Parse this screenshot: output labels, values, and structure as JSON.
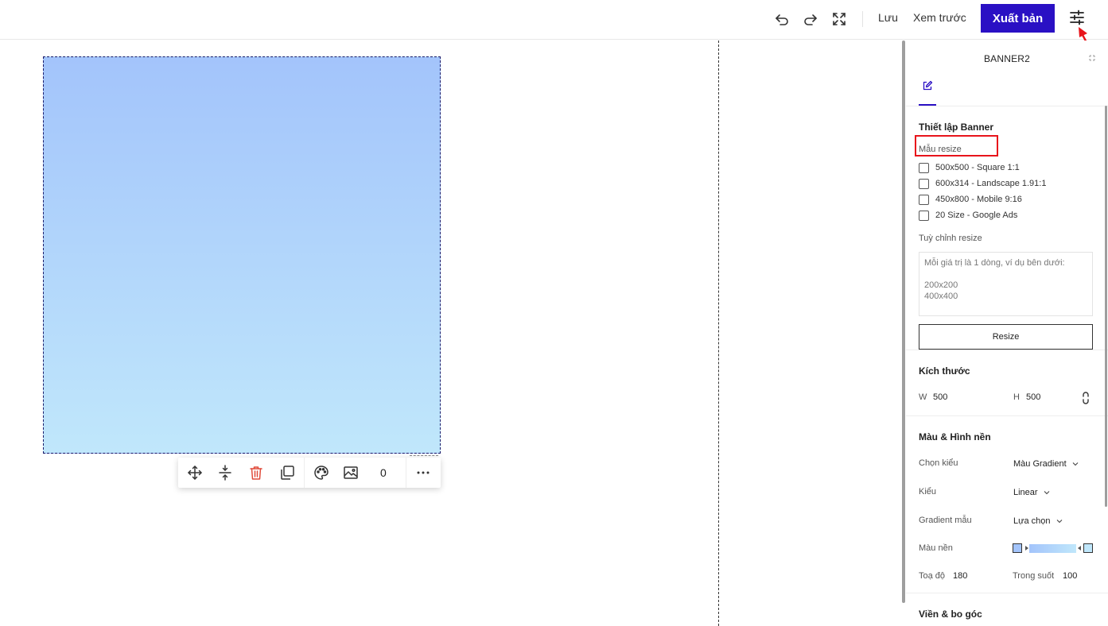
{
  "toolbar": {
    "save_label": "Lưu",
    "preview_label": "Xem trước",
    "publish_label": "Xuất bản"
  },
  "float_toolbar": {
    "layer_count": "0"
  },
  "panel": {
    "title": "BANNER2",
    "banner_settings": {
      "title": "Thiết lập Banner",
      "presets_label": "Mẫu resize",
      "presets": [
        {
          "label": "500x500 - Square 1:1",
          "checked": false
        },
        {
          "label": "600x314 - Landscape 1.91:1",
          "checked": false
        },
        {
          "label": "450x800 - Mobile 9:16",
          "checked": false
        },
        {
          "label": "20 Size - Google Ads",
          "checked": false
        }
      ],
      "custom_label": "Tuỳ chỉnh resize",
      "custom_placeholder": "Mỗi giá trị là 1 dòng, ví dụ bên dưới:\n\n200x200\n400x400",
      "resize_button": "Resize"
    },
    "size": {
      "title": "Kích thước",
      "w_label": "W",
      "w_value": "500",
      "h_label": "H",
      "h_value": "500"
    },
    "background": {
      "title": "Màu & Hình nền",
      "type_label": "Chọn kiểu",
      "type_value": "Màu Gradient",
      "style_label": "Kiểu",
      "style_value": "Linear",
      "preset_label": "Gradient mẫu",
      "preset_value": "Lựa chọn",
      "color_label": "Màu nền",
      "color_start": "#a3c4fb",
      "color_end": "#c0e7fb",
      "angle_label": "Toạ độ",
      "angle_value": "180",
      "opacity_label": "Trong suốt",
      "opacity_value": "100"
    },
    "border": {
      "title": "Viền & bo góc"
    }
  },
  "colors": {
    "accent": "#2a10c4",
    "highlight": "#e8141b"
  }
}
